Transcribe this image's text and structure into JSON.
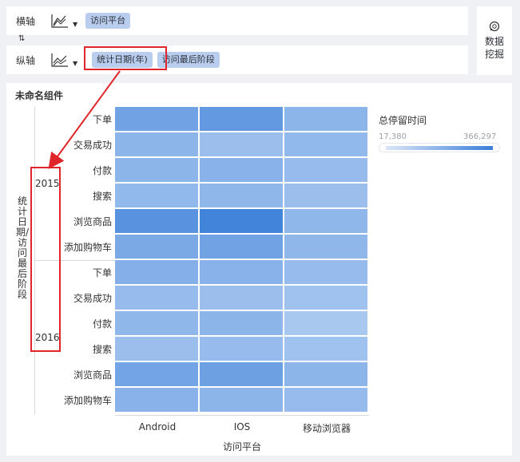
{
  "toolbar": {
    "x_axis": {
      "label": "横轴",
      "chart_icon": "area-chart-icon",
      "fields": [
        "访问平台"
      ]
    },
    "y_axis": {
      "label": "纵轴",
      "chart_icon": "line-chart-icon",
      "fields": [
        "统计日期(年)",
        "访问最后阶段"
      ]
    },
    "swap_icon": "⇅",
    "dropdown_arrow": "▼"
  },
  "mining": {
    "icon": "mining-icon",
    "label": "数据挖掘"
  },
  "component": {
    "title": "未命名组件",
    "y_title": "统计日期/访问最后阶段",
    "years": [
      "2015",
      "2016"
    ],
    "row_labels": [
      "下单",
      "交易成功",
      "付款",
      "搜索",
      "浏览商品",
      "添加购物车",
      "下单",
      "交易成功",
      "付款",
      "搜索",
      "浏览商品",
      "添加购物车"
    ],
    "x_labels": [
      "Android",
      "IOS",
      "移动浏览器"
    ],
    "x_title": "访问平台"
  },
  "legend": {
    "title": "总停留时间",
    "min": "17,380",
    "max": "366,297"
  },
  "colors": {
    "accent": "#3a7fd9",
    "pill": "#b9cdef",
    "highlight": "#e0262b"
  },
  "chart_data": {
    "type": "heatmap",
    "x": [
      "Android",
      "IOS",
      "移动浏览器"
    ],
    "y_groups": [
      "2015",
      "2016"
    ],
    "y": [
      "下单",
      "交易成功",
      "付款",
      "搜索",
      "浏览商品",
      "添加购物车",
      "下单",
      "交易成功",
      "付款",
      "搜索",
      "浏览商品",
      "添加购物车"
    ],
    "values": [
      [
        0.62,
        0.72,
        0.42
      ],
      [
        0.42,
        0.32,
        0.38
      ],
      [
        0.42,
        0.45,
        0.35
      ],
      [
        0.38,
        0.4,
        0.32
      ],
      [
        0.78,
        0.95,
        0.4
      ],
      [
        0.55,
        0.62,
        0.4
      ],
      [
        0.48,
        0.45,
        0.35
      ],
      [
        0.35,
        0.32,
        0.28
      ],
      [
        0.4,
        0.42,
        0.22
      ],
      [
        0.32,
        0.35,
        0.28
      ],
      [
        0.6,
        0.65,
        0.42
      ],
      [
        0.45,
        0.42,
        0.35
      ]
    ],
    "value_note": "relative intensity 0-1 read from colour scale",
    "legend_range": [
      17380,
      366297
    ]
  }
}
